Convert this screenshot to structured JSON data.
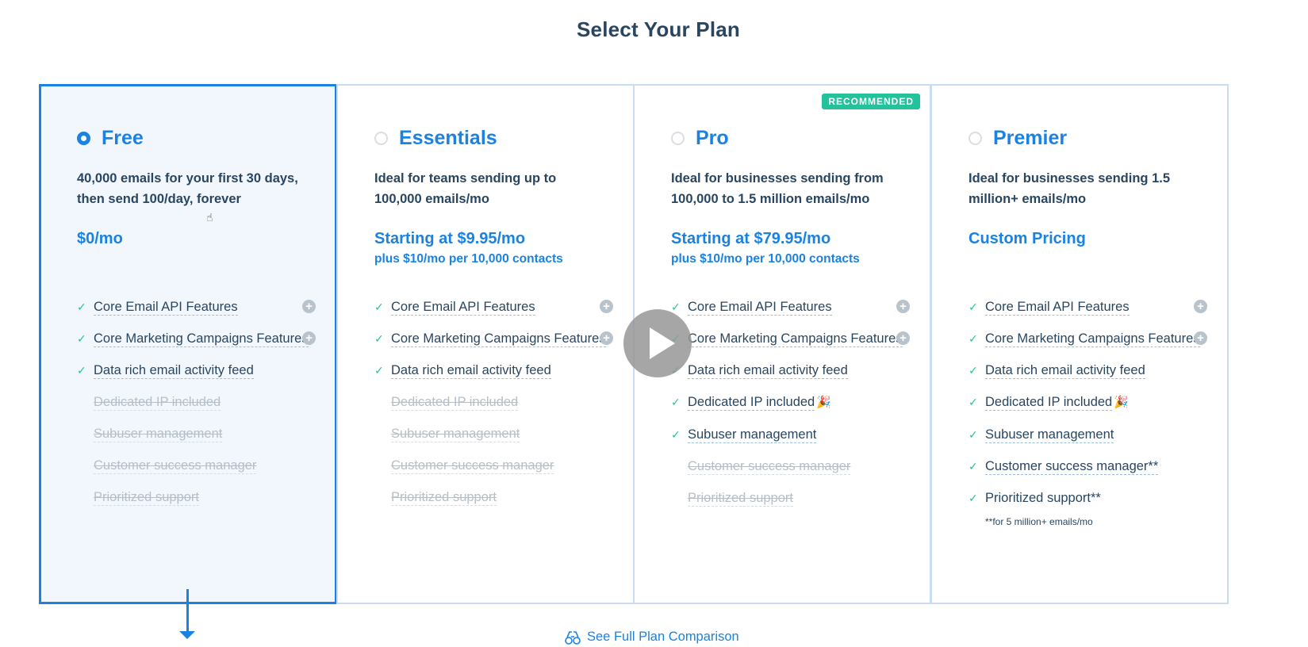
{
  "page": {
    "title": "Select Your Plan"
  },
  "plans": [
    {
      "name": "Free",
      "selected": true,
      "description": "40,000 emails for your first 30 days, then send 100/day, forever",
      "price": "$0/mo",
      "price_sub": "",
      "features": [
        {
          "text": "Core Email API Features",
          "included": true,
          "expandable": true
        },
        {
          "text": "Core Marketing Campaigns Features",
          "included": true,
          "expandable": true
        },
        {
          "text": "Data rich email activity feed",
          "included": true
        },
        {
          "text": "Dedicated IP included",
          "included": false
        },
        {
          "text": "Subuser management",
          "included": false
        },
        {
          "text": "Customer success manager",
          "included": false
        },
        {
          "text": "Prioritized support",
          "included": false
        }
      ]
    },
    {
      "name": "Essentials",
      "selected": false,
      "description": "Ideal for teams sending up to 100,000 emails/mo",
      "price": "Starting at $9.95/mo",
      "price_sub": "plus $10/mo per 10,000 contacts",
      "features": [
        {
          "text": "Core Email API Features",
          "included": true,
          "expandable": true
        },
        {
          "text": "Core Marketing Campaigns Features",
          "included": true,
          "expandable": true
        },
        {
          "text": "Data rich email activity feed",
          "included": true
        },
        {
          "text": "Dedicated IP included",
          "included": false
        },
        {
          "text": "Subuser management",
          "included": false
        },
        {
          "text": "Customer success manager",
          "included": false
        },
        {
          "text": "Prioritized support",
          "included": false
        }
      ]
    },
    {
      "name": "Pro",
      "selected": false,
      "badge": "RECOMMENDED",
      "description": "Ideal for businesses sending from 100,000 to 1.5 million emails/mo",
      "price": "Starting at $79.95/mo",
      "price_sub": "plus $10/mo per 10,000 contacts",
      "features": [
        {
          "text": "Core Email API Features",
          "included": true,
          "expandable": true
        },
        {
          "text": "Core Marketing Campaigns Features",
          "included": true,
          "expandable": true
        },
        {
          "text": "Data rich email activity feed",
          "included": true
        },
        {
          "text": "Dedicated IP included",
          "included": true,
          "emoji": "🎉"
        },
        {
          "text": "Subuser management",
          "included": true
        },
        {
          "text": "Customer success manager",
          "included": false
        },
        {
          "text": "Prioritized support",
          "included": false
        }
      ]
    },
    {
      "name": "Premier",
      "selected": false,
      "description": "Ideal for businesses sending 1.5 million+ emails/mo",
      "price": "Custom Pricing",
      "price_sub": "",
      "features": [
        {
          "text": "Core Email API Features",
          "included": true,
          "expandable": true
        },
        {
          "text": "Core Marketing Campaigns Features",
          "included": true,
          "expandable": true
        },
        {
          "text": "Data rich email activity feed",
          "included": true
        },
        {
          "text": "Dedicated IP included",
          "included": true,
          "emoji": "🎉"
        },
        {
          "text": "Subuser management",
          "included": true
        },
        {
          "text": "Customer success manager**",
          "included": true
        },
        {
          "text": "Prioritized support**",
          "included": true,
          "plain": true
        }
      ],
      "footnote": "**for 5 million+ emails/mo"
    }
  ],
  "footer": {
    "compare_link": "See Full Plan Comparison"
  },
  "icons": {
    "check": "check-icon",
    "plus": "plus-circle-icon",
    "play": "play-icon",
    "compare": "compare-icon"
  },
  "colors": {
    "accent": "#1a82e2",
    "text": "#294661",
    "check": "#23c29c",
    "badge": "#23c29c",
    "disabled": "#b6bfc8"
  }
}
